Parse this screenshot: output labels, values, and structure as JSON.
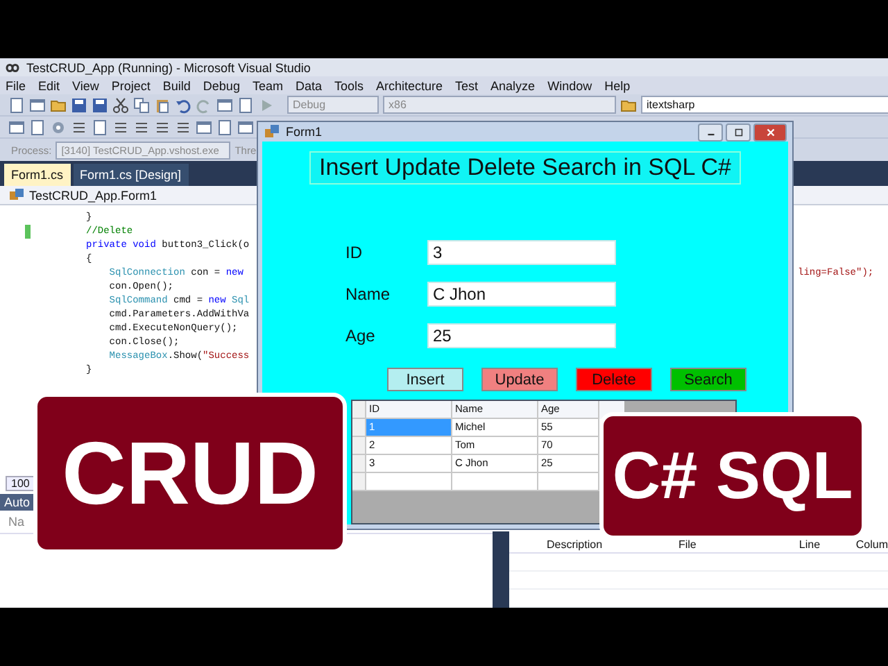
{
  "window": {
    "title": "TestCRUD_App (Running) - Microsoft Visual Studio"
  },
  "menu": [
    "File",
    "Edit",
    "View",
    "Project",
    "Build",
    "Debug",
    "Team",
    "Data",
    "Tools",
    "Architecture",
    "Test",
    "Analyze",
    "Window",
    "Help"
  ],
  "toolbar": {
    "configuration": "Debug",
    "platform": "x86",
    "search": "itextsharp"
  },
  "process_bar": {
    "label": "Process:",
    "process": "[3140] TestCRUD_App.vshost.exe",
    "thread_label": "Thre"
  },
  "editor_tabs": [
    {
      "label": "Form1.cs",
      "selected": true
    },
    {
      "label": "Form1.cs [Design]",
      "selected": false
    }
  ],
  "navigation": "TestCRUD_App.Form1",
  "code_lines": [
    {
      "changed": false,
      "tokens": [
        {
          "text": "}",
          "kind": "plain"
        }
      ]
    },
    {
      "changed": true,
      "tokens": [
        {
          "text": "//Delete",
          "kind": "comment"
        }
      ]
    },
    {
      "changed": false,
      "tokens": [
        {
          "text": "private void",
          "kind": "keyword"
        },
        {
          "text": " button3_Click(o",
          "kind": "plain"
        }
      ]
    },
    {
      "changed": false,
      "tokens": [
        {
          "text": "{",
          "kind": "plain"
        }
      ]
    },
    {
      "changed": false,
      "tokens": [
        {
          "text": "    SqlConnection",
          "kind": "type"
        },
        {
          "text": " con = ",
          "kind": "plain"
        },
        {
          "text": "new",
          "kind": "keyword"
        }
      ]
    },
    {
      "changed": false,
      "tokens": [
        {
          "text": "    con.Open();",
          "kind": "plain"
        }
      ]
    },
    {
      "changed": false,
      "tokens": [
        {
          "text": "    SqlCommand",
          "kind": "type"
        },
        {
          "text": " cmd = ",
          "kind": "plain"
        },
        {
          "text": "new",
          "kind": "keyword"
        },
        {
          "text": " Sql",
          "kind": "type"
        }
      ]
    },
    {
      "changed": false,
      "tokens": [
        {
          "text": "    cmd.Parameters.AddWithVa",
          "kind": "plain"
        }
      ]
    },
    {
      "changed": false,
      "tokens": [
        {
          "text": "    cmd.ExecuteNonQuery();",
          "kind": "plain"
        }
      ]
    },
    {
      "changed": false,
      "tokens": [
        {
          "text": "    con.Close();",
          "kind": "plain"
        }
      ]
    },
    {
      "changed": false,
      "tokens": [
        {
          "text": "    MessageBox",
          "kind": "type"
        },
        {
          "text": ".Show(",
          "kind": "plain"
        },
        {
          "text": "\"Success",
          "kind": "string"
        }
      ]
    },
    {
      "changed": false,
      "tokens": [
        {
          "text": "}",
          "kind": "plain"
        }
      ]
    }
  ],
  "editor_right_text": "ling=False\");",
  "zoom": "100",
  "form": {
    "title": "Form1",
    "heading": "Insert Update Delete Search in SQL C#",
    "fields": [
      {
        "label": "ID",
        "value": "3"
      },
      {
        "label": "Name",
        "value": "C Jhon"
      },
      {
        "label": "Age",
        "value": "25"
      }
    ],
    "buttons": [
      {
        "label": "Insert",
        "color": "#b4eef0"
      },
      {
        "label": "Update",
        "color": "#f08080"
      },
      {
        "label": "Delete",
        "color": "#ff0000"
      },
      {
        "label": "Search",
        "color": "#00c000"
      }
    ],
    "grid": {
      "columns": [
        "ID",
        "Name",
        "Age"
      ],
      "rows": [
        {
          "cells": [
            "1",
            "Michel",
            "55"
          ],
          "selected": true
        },
        {
          "cells": [
            "2",
            "Tom",
            "70"
          ],
          "selected": false
        },
        {
          "cells": [
            "3",
            "C Jhon",
            "25"
          ],
          "selected": false
        }
      ]
    }
  },
  "autos_panel": {
    "title": "Auto",
    "column": "Na"
  },
  "error_list": {
    "columns": [
      "Description",
      "File",
      "Line",
      "Colum"
    ]
  },
  "badges": [
    {
      "text": "CRUD"
    },
    {
      "text": "C# SQL"
    }
  ]
}
